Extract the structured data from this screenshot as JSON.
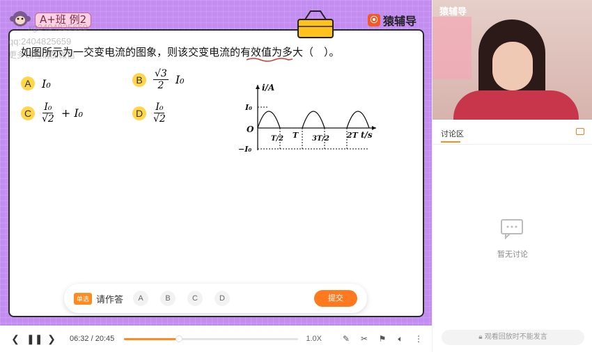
{
  "board": {
    "class_tag": "A+班  例2",
    "watermarks": [
      "xg2404825659",
      "qq:2404825659",
      "更多课程请加微信"
    ],
    "brand": "猿辅导",
    "brand_icon": "⦿",
    "question": "如图所示为一交变电流的图象，则该交变电流的有效值为多大（　）。",
    "options": [
      {
        "letter": "A",
        "num": "",
        "den": "",
        "text": "I₀"
      },
      {
        "letter": "B",
        "num": "√3",
        "den": "2",
        "text": "I₀"
      },
      {
        "letter": "C",
        "num": "I₀",
        "den": "√2",
        "text": "+ I₀"
      },
      {
        "letter": "D",
        "num": "I₀",
        "den": "√2",
        "text": ""
      }
    ],
    "graph": {
      "y_label": "i/A",
      "x_label": "t/s",
      "origin": "O",
      "top_tick": "I₀",
      "bottom_tick": "−I₀",
      "x_ticks": [
        "T/2",
        "T",
        "3T/2",
        "2T"
      ]
    }
  },
  "answer_bar": {
    "tag": "单选",
    "prompt": "请作答",
    "choices": [
      "A",
      "B",
      "C",
      "D"
    ],
    "submit": "提交"
  },
  "playbar": {
    "current_time": "06:32",
    "separator": "/",
    "total_time": "20:45",
    "progress": 0.315,
    "speed": "1.0X"
  },
  "right": {
    "video_brand": "猿辅导",
    "discuss_tab": "讨论区",
    "empty_text": "暂无讨论",
    "notice": "观看回放时不能发言"
  }
}
